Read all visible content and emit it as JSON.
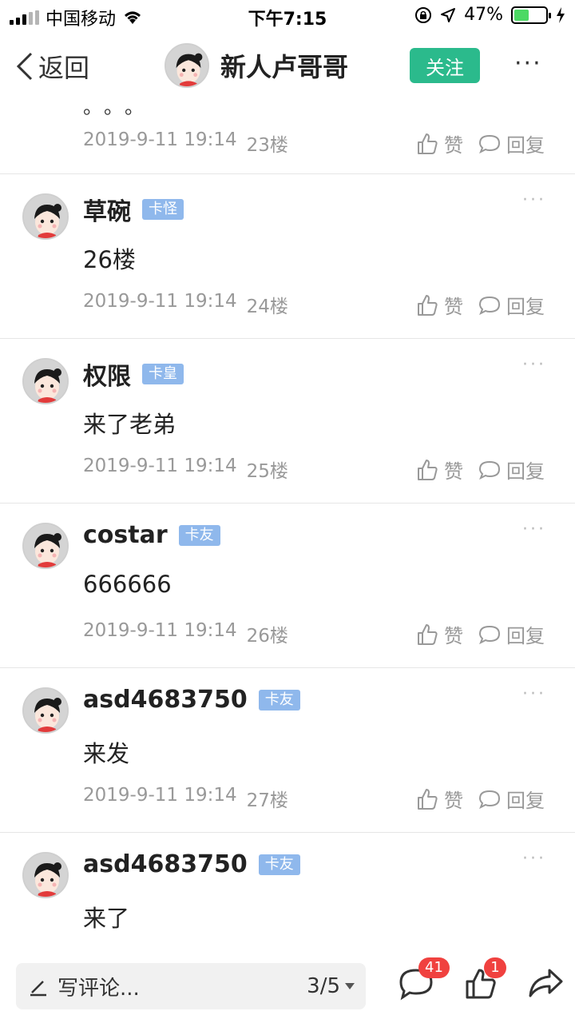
{
  "status_bar": {
    "carrier": "中国移动",
    "time": "下午7:15",
    "battery_text": "47%",
    "battery_level": 0.47,
    "icons": [
      "signal-icon",
      "wifi-icon",
      "orientation-lock-icon",
      "location-icon",
      "battery-icon",
      "charging-icon"
    ]
  },
  "nav": {
    "back_label": "返回",
    "title": "新人卢哥哥",
    "follow_label": "关注",
    "more_label": "···"
  },
  "partial_comment": {
    "text": "。。。",
    "date": "2019-9-11 19:14",
    "floor": "23楼",
    "like_label": "赞",
    "reply_label": "回复"
  },
  "comments": [
    {
      "name": "草碗",
      "badge": "卡怪",
      "text": "26楼",
      "date": "2019-9-11 19:14",
      "floor": "24楼",
      "like_label": "赞",
      "reply_label": "回复"
    },
    {
      "name": "权限",
      "badge": "卡皇",
      "text": "来了老弟",
      "date": "2019-9-11 19:14",
      "floor": "25楼",
      "like_label": "赞",
      "reply_label": "回复"
    },
    {
      "name": "costar",
      "badge": "卡友",
      "text": "666666",
      "date": "2019-9-11 19:14",
      "floor": "26楼",
      "like_label": "赞",
      "reply_label": "回复"
    },
    {
      "name": "asd4683750",
      "badge": "卡友",
      "text": "来发",
      "date": "2019-9-11 19:14",
      "floor": "27楼",
      "like_label": "赞",
      "reply_label": "回复"
    },
    {
      "name": "asd4683750",
      "badge": "卡友",
      "text": "来了"
    }
  ],
  "bottom_bar": {
    "compose_placeholder": "写评论...",
    "page_indicator": "3/5",
    "comment_count": "41",
    "like_count": "1"
  },
  "colors": {
    "follow_green": "#2bba8c",
    "badge_blue": "#8fb8ec",
    "count_red": "#f0413f"
  }
}
